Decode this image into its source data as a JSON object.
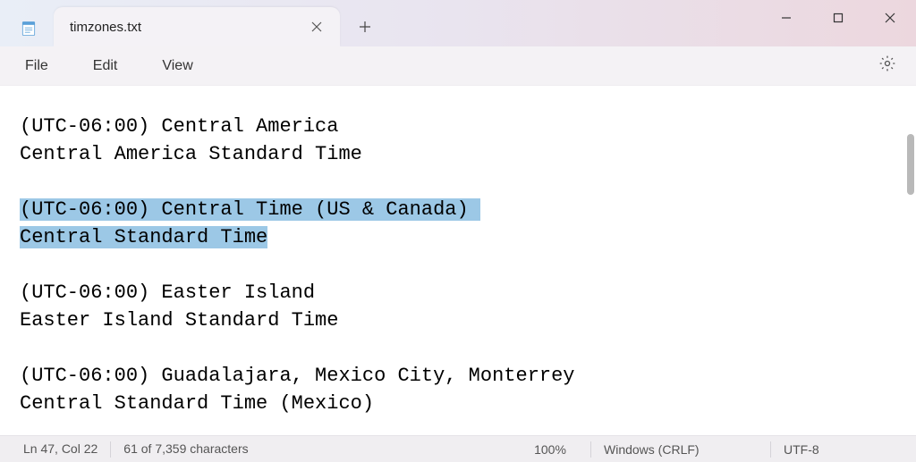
{
  "tab": {
    "title": "timzones.txt"
  },
  "menu": {
    "file": "File",
    "edit": "Edit",
    "view": "View"
  },
  "content": {
    "l1": "(UTC-06:00) Central America",
    "l2": "Central America Standard Time",
    "l3": "",
    "sel1": "(UTC-06:00) Central Time (US & Canada)",
    "sel2": "Central Standard Time",
    "l6": "",
    "l7": "(UTC-06:00) Easter Island",
    "l8": "Easter Island Standard Time",
    "l9": "",
    "l10": "(UTC-06:00) Guadalajara, Mexico City, Monterrey",
    "l11": "Central Standard Time (Mexico)"
  },
  "status": {
    "position": "Ln 47, Col 22",
    "selection": "61 of 7,359 characters",
    "zoom": "100%",
    "eol": "Windows (CRLF)",
    "encoding": "UTF-8"
  }
}
